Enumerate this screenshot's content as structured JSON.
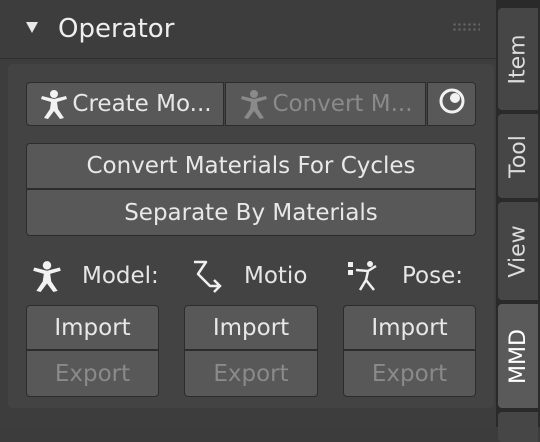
{
  "panel": {
    "title": "Operator",
    "row1": {
      "create_model_label": "Create Mo...",
      "convert_model_label": "Convert M...",
      "create_icon": "person-icon",
      "convert_icon": "person-icon",
      "toggle_icon": "circle-dot-icon"
    },
    "convert_materials_label": "Convert Materials For Cycles",
    "separate_materials_label": "Separate By Materials",
    "columns": [
      {
        "label": "Model:",
        "icon": "person-icon",
        "import_label": "Import",
        "export_label": "Export"
      },
      {
        "label": "Motio",
        "icon": "motion-arrow-icon",
        "import_label": "Import",
        "export_label": "Export"
      },
      {
        "label": "Pose:",
        "icon": "pose-icon",
        "import_label": "Import",
        "export_label": "Export"
      }
    ]
  },
  "tabs": [
    {
      "label": "Item",
      "active": false
    },
    {
      "label": "Tool",
      "active": false
    },
    {
      "label": "View",
      "active": false
    },
    {
      "label": "MMD",
      "active": true
    }
  ],
  "colors": {
    "panel_bg": "#3d3d3d",
    "button_bg": "#585858",
    "text": "#e6e6e6",
    "disabled_text": "#8a8a8a",
    "tab_bar": "#2a2a2a"
  }
}
